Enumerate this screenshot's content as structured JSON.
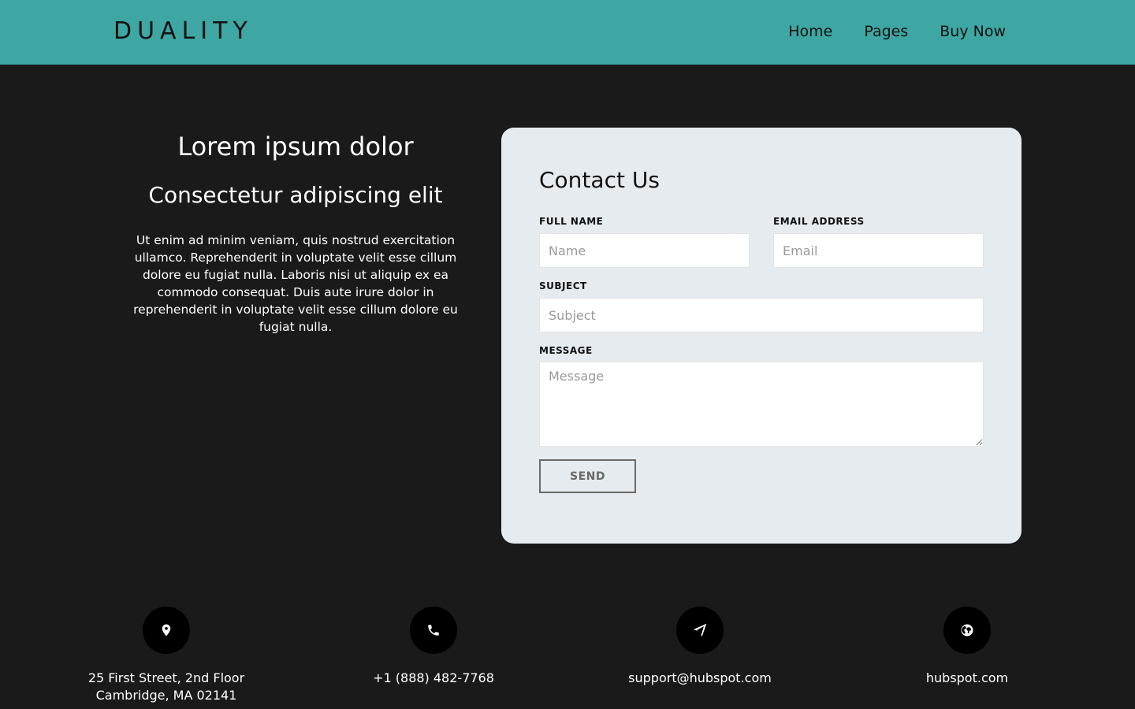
{
  "header": {
    "logo": "DUALITY",
    "nav": [
      "Home",
      "Pages",
      "Buy Now"
    ]
  },
  "intro": {
    "title": "Lorem ipsum dolor",
    "subtitle": "Consectetur adipiscing elit",
    "body": "Ut enim ad minim veniam, quis nostrud exercitation ullamco. Reprehenderit in voluptate velit esse cillum dolore eu fugiat nulla. Laboris nisi ut aliquip ex ea commodo consequat. Duis aute irure dolor in reprehenderit in voluptate velit esse cillum dolore eu fugiat nulla."
  },
  "contact_form": {
    "title": "Contact Us",
    "full_name": {
      "label": "FULL NAME",
      "placeholder": "Name",
      "value": ""
    },
    "email": {
      "label": "EMAIL ADDRESS",
      "placeholder": "Email",
      "value": ""
    },
    "subject": {
      "label": "SUBJECT",
      "placeholder": "Subject",
      "value": ""
    },
    "message": {
      "label": "MESSAGE",
      "placeholder": "Message",
      "value": ""
    },
    "send_label": "SEND"
  },
  "contact_info": [
    {
      "icon": "map-pin-icon",
      "lines": [
        "25 First Street, 2nd Floor",
        "Cambridge, MA 02141"
      ]
    },
    {
      "icon": "phone-icon",
      "lines": [
        "+1 (888) 482-7768"
      ]
    },
    {
      "icon": "paper-plane-icon",
      "lines": [
        "support@hubspot.com"
      ]
    },
    {
      "icon": "globe-icon",
      "lines": [
        "hubspot.com"
      ]
    }
  ],
  "colors": {
    "header_bg": "#3ea6a3",
    "page_bg": "#1a1a1b",
    "card_bg": "#e6ebef",
    "icon_circle": "#000000"
  }
}
